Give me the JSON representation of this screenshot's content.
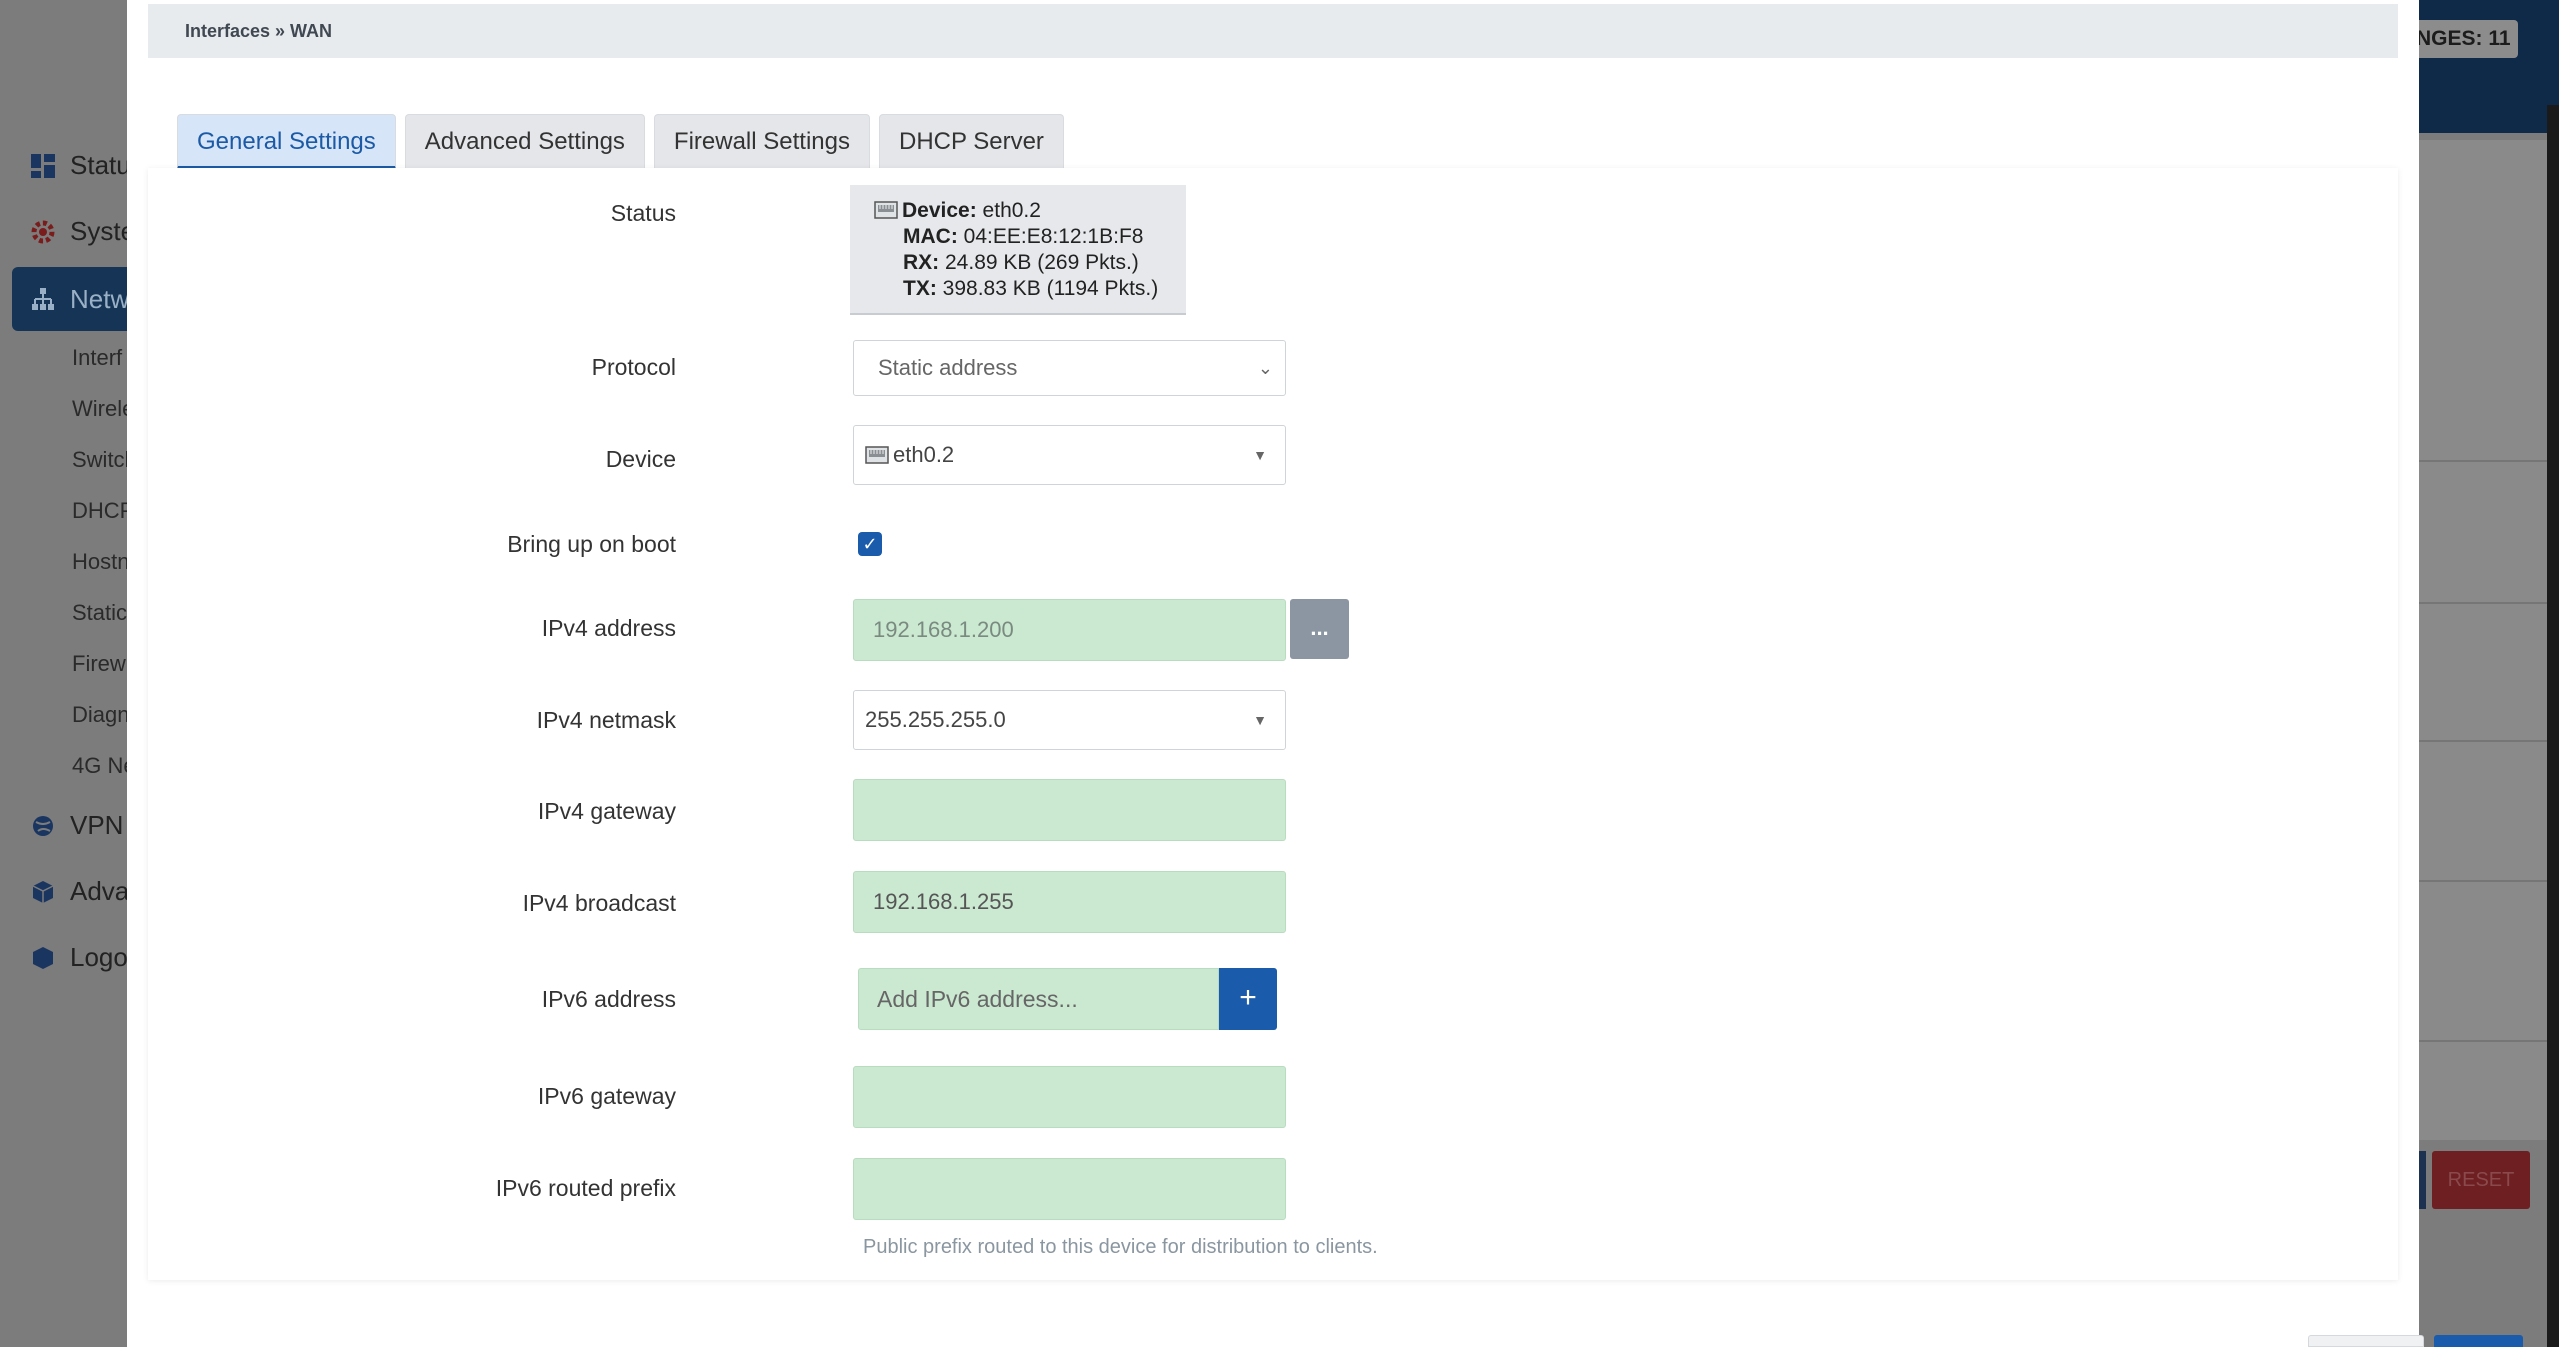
{
  "breadcrumb": "Interfaces » WAN",
  "background": {
    "changes_badge": "NGES: 11",
    "reset_label": "RESET",
    "nav_items": [
      {
        "label": "Statu",
        "icon": "dashboard-icon"
      },
      {
        "label": "Syste",
        "icon": "gear-icon"
      },
      {
        "label": "Netw",
        "icon": "network-icon"
      },
      {
        "label": "VPN",
        "icon": "globe-icon"
      },
      {
        "label": "Adva",
        "icon": "cube-icon"
      },
      {
        "label": "Logo",
        "icon": "logout-icon"
      }
    ],
    "sub_items": [
      "Interf",
      "Wirele",
      "Switch",
      "DHCP",
      "Hostn",
      "Static",
      "Firew",
      "Diagn",
      "4G Ne"
    ]
  },
  "tabs": [
    {
      "label": "General Settings",
      "active": true
    },
    {
      "label": "Advanced Settings",
      "active": false
    },
    {
      "label": "Firewall Settings",
      "active": false
    },
    {
      "label": "DHCP Server",
      "active": false
    }
  ],
  "form": {
    "status": {
      "label": "Status",
      "device_key": "Device:",
      "device_val": " eth0.2",
      "mac_key": "MAC:",
      "mac_val": " 04:EE:E8:12:1B:F8",
      "rx_key": "RX:",
      "rx_val": " 24.89 KB (269 Pkts.)",
      "tx_key": "TX:",
      "tx_val": " 398.83 KB (1194 Pkts.)"
    },
    "protocol": {
      "label": "Protocol",
      "value": "Static address"
    },
    "device": {
      "label": "Device",
      "value": "eth0.2"
    },
    "bring_up": {
      "label": "Bring up on boot",
      "checked": true
    },
    "ipv4_address": {
      "label": "IPv4 address",
      "placeholder": "192.168.1.200",
      "button": "..."
    },
    "ipv4_netmask": {
      "label": "IPv4 netmask",
      "value": "255.255.255.0"
    },
    "ipv4_gateway": {
      "label": "IPv4 gateway",
      "value": ""
    },
    "ipv4_broadcast": {
      "label": "IPv4 broadcast",
      "value": "192.168.1.255"
    },
    "ipv6_address": {
      "label": "IPv6 address",
      "placeholder": "Add IPv6 address...",
      "button": "+"
    },
    "ipv6_gateway": {
      "label": "IPv6 gateway",
      "value": ""
    },
    "ipv6_prefix": {
      "label": "IPv6 routed prefix",
      "value": "",
      "hint": "Public prefix routed to this device for distribution to clients."
    }
  },
  "colors": {
    "accent": "#1a5cab",
    "input_bg": "#cbe8d1",
    "tab_active_bg": "#d6e6f8"
  }
}
